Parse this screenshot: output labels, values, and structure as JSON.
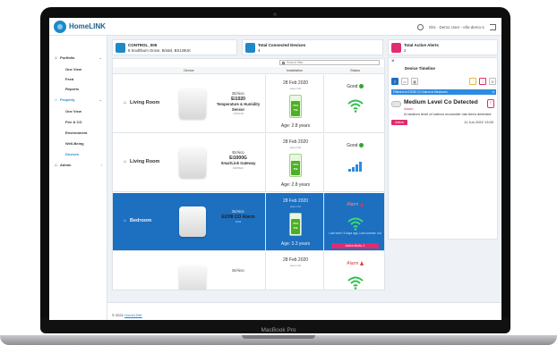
{
  "device_frame": {
    "brand": "MacBook Pro"
  },
  "app": {
    "logo_text": "HomeLINK"
  },
  "topbar": {
    "user_label": "Elsi · Demo User - ello-demo-1"
  },
  "sidebar": {
    "items": [
      {
        "label": "Portfolio",
        "type": "head",
        "chevron": "⌄"
      },
      {
        "label": "One View",
        "type": "sub"
      },
      {
        "label": "Feed",
        "type": "sub"
      },
      {
        "label": "Reports",
        "type": "sub"
      },
      {
        "label": "Property",
        "type": "head",
        "chevron": "⌄"
      },
      {
        "label": "One View",
        "type": "sub"
      },
      {
        "label": "Fire & CO",
        "type": "sub"
      },
      {
        "label": "Environment",
        "type": "sub"
      },
      {
        "label": "Well-Being",
        "type": "sub"
      },
      {
        "label": "Devices",
        "type": "sub",
        "active": true
      },
      {
        "label": "Admin",
        "type": "head",
        "chevron": "›"
      }
    ]
  },
  "cards": {
    "property": {
      "title": "CONTROL_005",
      "address": "8 Southburn Grove, Bristol, BS129UK"
    },
    "devices": {
      "title": "Total Connected Devices",
      "value": "4"
    },
    "alerts": {
      "title": "Total Active Alerts",
      "value": "2"
    }
  },
  "table": {
    "search_placeholder": "Search filter",
    "headers": {
      "device": "Device",
      "installation": "Installation",
      "status": "Status"
    },
    "rows": [
      {
        "room": "Living Room",
        "brand": "EI/Aico",
        "model": "Ei1020",
        "type": "Temperature & Humidity Sensor",
        "serial": "1700716",
        "date": "28 Feb 2020",
        "installer": "aoip.vmtt",
        "batt_top": "75%",
        "batt_bottom": "73k",
        "battery_level": 0.75,
        "age": "Age: 2.8 years",
        "status": "Good",
        "status_kind": "good",
        "signal": "wifi"
      },
      {
        "room": "Living Room",
        "brand": "EI/Aico",
        "model": "Ei1000G",
        "type": "SmartLink Gateway",
        "serial": "8025642",
        "date": "28 Feb 2020",
        "installer": "aoip.vmtt",
        "batt_top": "74%",
        "batt_bottom": "70k",
        "battery_level": 0.74,
        "age": "Age: 2.8 years",
        "status": "Good",
        "status_kind": "good",
        "signal": "bars"
      },
      {
        "room": "Bedroom",
        "brand": "EI/Aico",
        "model": "Ei208 CO Alarm",
        "type": "",
        "serial": "1602",
        "date": "28 Feb 2020",
        "installer": "aoip.vmtt",
        "batt_top": "75%",
        "batt_bottom": "70k",
        "battery_level": 0.75,
        "age": "Age: 3.3 years",
        "status": "Alarm",
        "status_kind": "alarm",
        "signal": "wifi",
        "message": "Last seen: 5 days ago, Last comms: not",
        "active_alerts": "Active Alerts: 1"
      },
      {
        "room": "",
        "brand": "EI/Aico",
        "model": "",
        "type": "",
        "serial": "",
        "date": "28 Feb 2020",
        "installer": "aoip.vmtt",
        "batt_top": "",
        "batt_bottom": "",
        "battery_level": 0,
        "age": "",
        "status": "Alarm",
        "status_kind": "alarm",
        "signal": "wifi"
      }
    ]
  },
  "alerts_panel": {
    "close": "×",
    "title": "Device Timeline",
    "tools": [
      "≡",
      "▭",
      "▦"
    ],
    "tools_right": [
      "♡",
      "!",
      "⊘"
    ],
    "filter": "Filtered to Ei208 CO Alarm in Bedroom",
    "filter_close": "×",
    "alert_title": "Medium Level Co Detected",
    "alert_category": "Alarm",
    "alert_desc": "A medium level of carbon monoxide has been detected",
    "alert_status": "Active",
    "alert_time": "11 Jun 2022 13:00"
  },
  "footer": {
    "prefix": "© 2021",
    "link": "HomeLINK"
  },
  "colors": {
    "accent": "#1e88c9",
    "selected_row": "#1d6fc0",
    "alarm": "#e22b6e",
    "good": "#33a532"
  }
}
